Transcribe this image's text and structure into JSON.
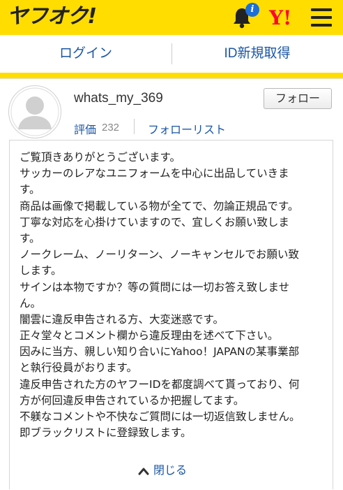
{
  "header": {
    "logo_text": "ヤフオク!",
    "bell_icon": "bell-icon",
    "notification_badge": "i",
    "yahoo_logo": "Y!",
    "menu_icon": "hamburger-menu-icon",
    "brand_color": "#ffdd00"
  },
  "login_bar": {
    "login_label": "ログイン",
    "signup_label": "ID新規取得",
    "link_color": "#1a56a5"
  },
  "profile": {
    "username": "whats_my_369",
    "follow_label": "フォロー",
    "rating_label": "評価",
    "rating_count": "232",
    "follow_list_label": "フォローリスト",
    "avatar_icon": "default-user-avatar-icon"
  },
  "intro": {
    "lines": [
      "ご覧頂きありがとうございます。",
      "サッカーのレアなユニフォームを中心に出品していきま",
      "す。",
      "商品は画像で掲載している物が全てで、勿論正規品です。",
      "丁寧な対応を心掛けていますので、宜しくお願い致しま",
      "す。",
      "ノークレーム、ノーリターン、ノーキャンセルでお願い致",
      "します。",
      "サインは本物ですか？等の質問には一切お答え致しませ",
      "ん。",
      "闇雲に違反申告される方、大変迷惑です。",
      "正々堂々とコメント欄から違反理由を述べて下さい。",
      "因みに当方、親しい知り合いにYahoo！JAPANの某事業部",
      "と執行役員がおります。",
      "違反申告された方のヤフーIDを都度調べて貰っており、何",
      "方が何回違反申告されているか把握してます。",
      "不躾なコメントや不快なご質問には一切返信致しません。",
      "即ブラックリストに登録致します。"
    ],
    "close_label": "閉じる",
    "close_icon": "chevron-up-icon"
  }
}
